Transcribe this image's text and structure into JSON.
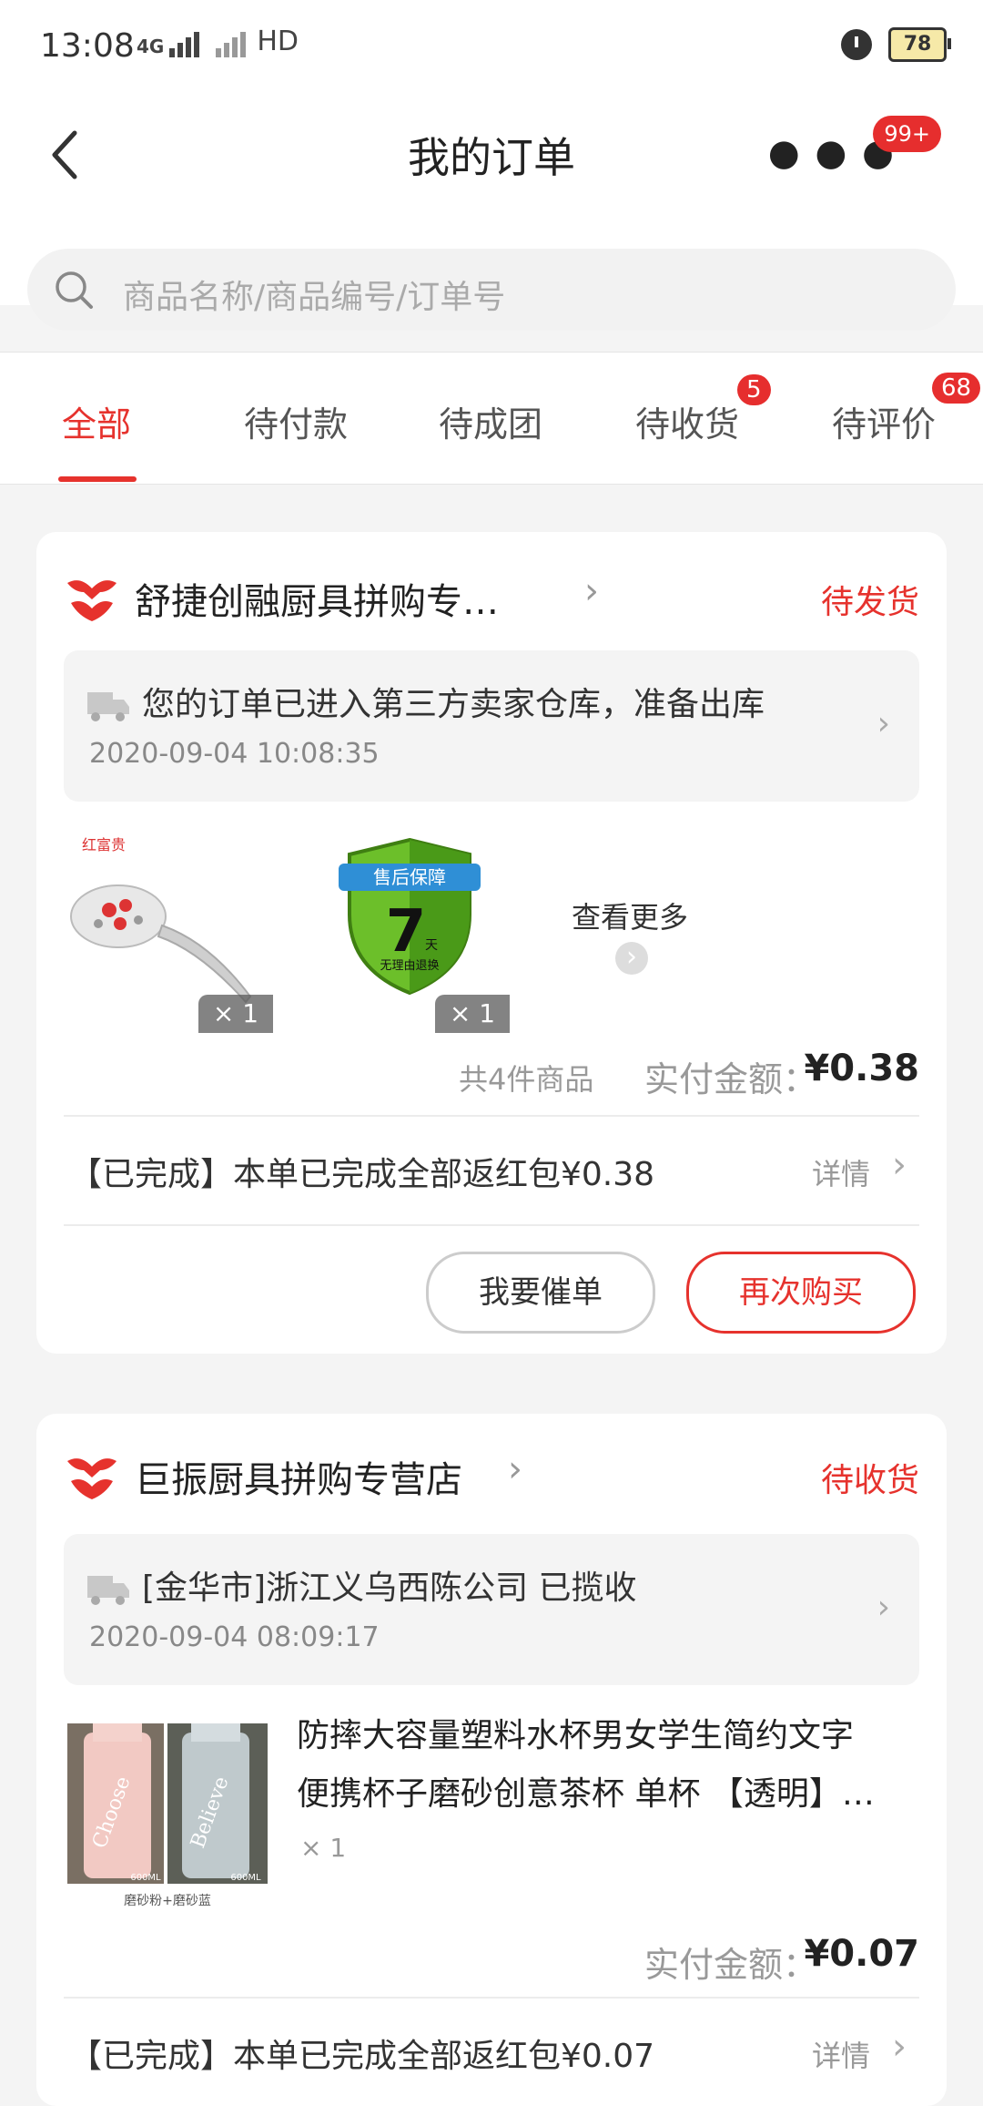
{
  "status_bar": {
    "time": "13:08",
    "network": "4G",
    "hd": "HD",
    "battery": "78"
  },
  "header": {
    "title": "我的订单",
    "more_icon": "more-dots-icon",
    "more_badge": "99+",
    "search_placeholder": "商品名称/商品编号/订单号"
  },
  "tabs": [
    {
      "label": "全部",
      "active": true
    },
    {
      "label": "待付款"
    },
    {
      "label": "待成团"
    },
    {
      "label": "待收货",
      "badge": "5"
    },
    {
      "label": "待评价",
      "badge": "68"
    }
  ],
  "orders": [
    {
      "shop": "舒捷创融厨具拼购专…",
      "status": "待发货",
      "tracking": {
        "text": "您的订单已进入第三方卖家仓库，准备出库",
        "time": "2020-09-04 10:08:35"
      },
      "items": [
        {
          "name": "spoon",
          "brand": "红富贵",
          "qty": "× 1"
        },
        {
          "name": "after-sale-shield",
          "shield_title": "售后保障",
          "shield_days": "7",
          "shield_unit": "天",
          "shield_sub": "无理由退换",
          "qty": "× 1"
        }
      ],
      "see_more": "查看更多",
      "total_count": "共4件商品",
      "paid_label": "实付金额：",
      "paid_value": "¥0.38",
      "rebate": "【已完成】本单已完成全部返红包¥0.38",
      "details": "详情",
      "buttons": {
        "urge": "我要催单",
        "rebuy": "再次购买"
      }
    },
    {
      "shop": "巨振厨具拼购专营店",
      "status": "待收货",
      "tracking": {
        "text": "[金华市]浙江义乌西陈公司 已揽收",
        "time": "2020-09-04 08:09:17"
      },
      "product_title_line1": "防摔大容量塑料水杯男女学生简约文字",
      "product_title_line2": "便携杯子磨砂创意茶杯 单杯 【透明】…",
      "qty": "× 1",
      "img_caption": "磨砂粉+磨砂蓝",
      "bottle_text_1": "Choose",
      "bottle_text_2": "Believe",
      "bottle_size": "600ML",
      "paid_label": "实付金额：",
      "paid_value": "¥0.07",
      "rebate": "【已完成】本单已完成全部返红包¥0.07",
      "details": "详情"
    }
  ],
  "colors": {
    "accent": "#e6322d",
    "background": "#f4f4f4"
  }
}
